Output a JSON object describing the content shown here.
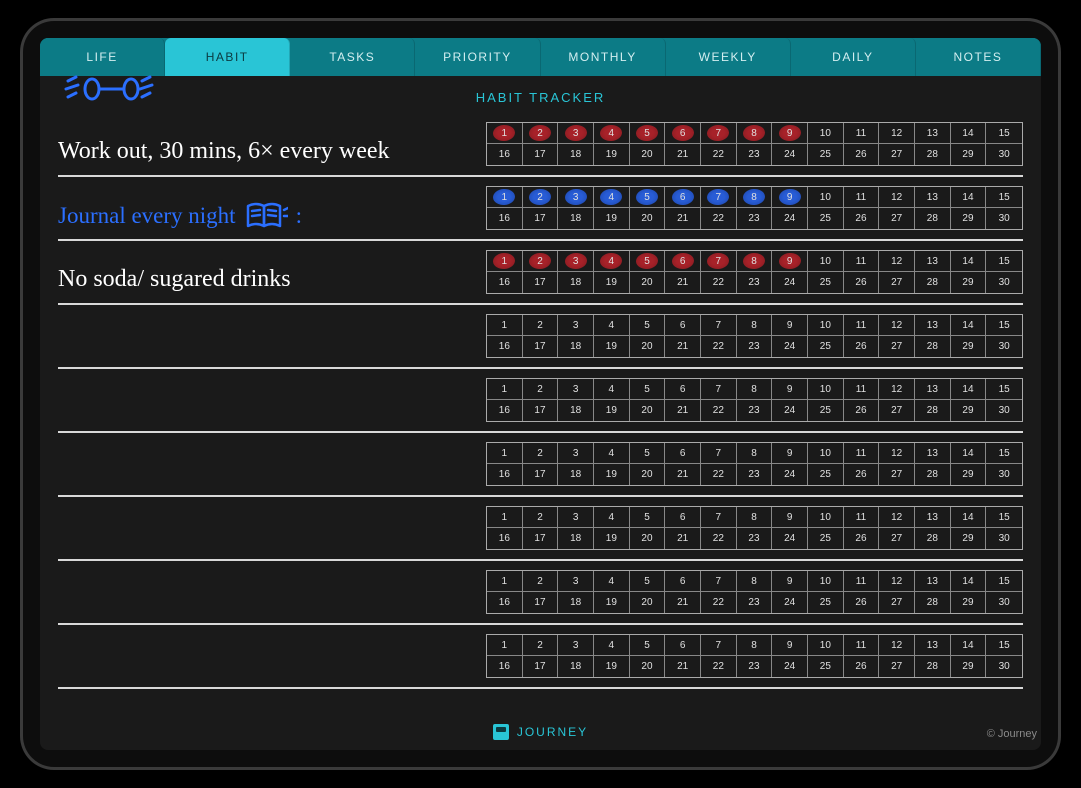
{
  "tabs": [
    {
      "label": "LIFE",
      "active": false
    },
    {
      "label": "HABIT",
      "active": true
    },
    {
      "label": "TASKS",
      "active": false
    },
    {
      "label": "PRIORITY",
      "active": false
    },
    {
      "label": "MONTHLY",
      "active": false
    },
    {
      "label": "WEEKLY",
      "active": false
    },
    {
      "label": "DAILY",
      "active": false
    },
    {
      "label": "NOTES",
      "active": false
    }
  ],
  "page_title": "HABIT TRACKER",
  "habits": [
    {
      "text": "Work out, 30 mins, 6× every week",
      "style": "white",
      "icon": "dumbbell",
      "marked": [
        1,
        2,
        3,
        4,
        5,
        6,
        7,
        8,
        9
      ],
      "mark_color": "red"
    },
    {
      "text": "Journal every night",
      "style": "blue",
      "icon": "book",
      "marked": [
        1,
        2,
        3,
        4,
        5,
        6,
        7,
        8,
        9
      ],
      "mark_color": "blue"
    },
    {
      "text": "No soda/ sugared drinks",
      "style": "white",
      "icon": null,
      "marked": [
        1,
        2,
        3,
        4,
        5,
        6,
        7,
        8,
        9
      ],
      "mark_color": "red"
    },
    {
      "text": "",
      "style": "white",
      "icon": null,
      "marked": [],
      "mark_color": "red"
    },
    {
      "text": "",
      "style": "white",
      "icon": null,
      "marked": [],
      "mark_color": "red"
    },
    {
      "text": "",
      "style": "white",
      "icon": null,
      "marked": [],
      "mark_color": "red"
    },
    {
      "text": "",
      "style": "white",
      "icon": null,
      "marked": [],
      "mark_color": "red"
    },
    {
      "text": "",
      "style": "white",
      "icon": null,
      "marked": [],
      "mark_color": "red"
    },
    {
      "text": "",
      "style": "white",
      "icon": null,
      "marked": [],
      "mark_color": "red"
    }
  ],
  "days_per_row": 30,
  "footer": {
    "brand": "JOURNEY",
    "copyright": "© Journey"
  }
}
